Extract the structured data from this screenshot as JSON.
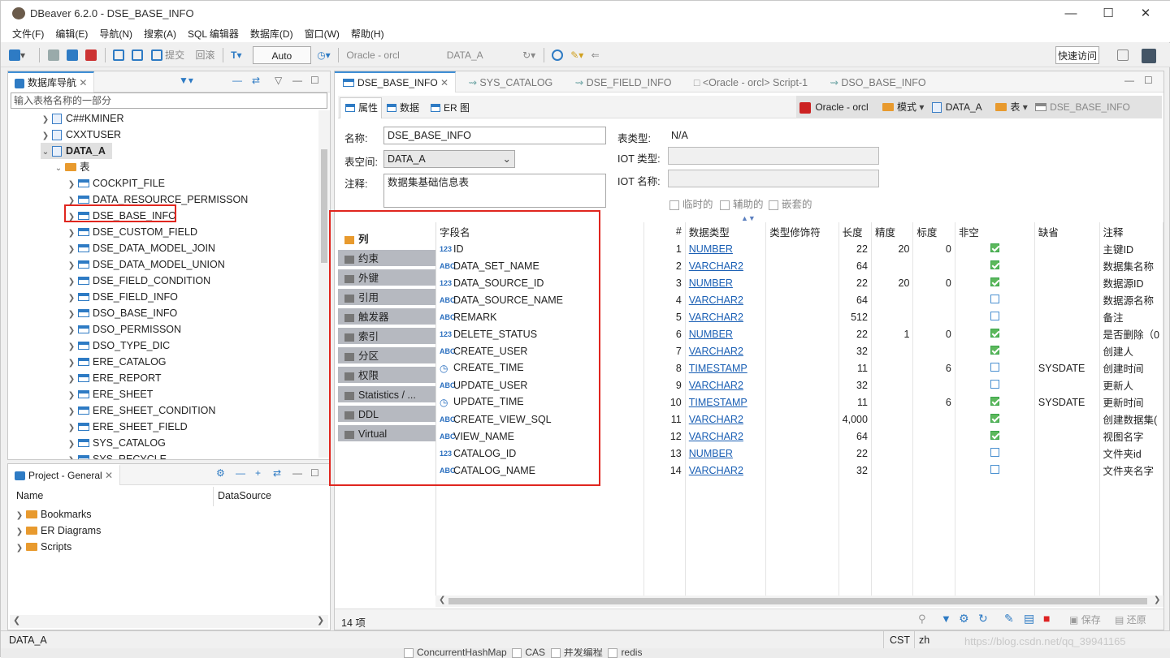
{
  "window": {
    "title": "DBeaver 6.2.0 - DSE_BASE_INFO"
  },
  "menu": [
    "文件(F)",
    "编辑(E)",
    "导航(N)",
    "搜索(A)",
    "SQL 编辑器",
    "数据库(D)",
    "窗口(W)",
    "帮助(H)"
  ],
  "toolbar": {
    "commit": "提交",
    "rollback": "回滚",
    "mode": "Auto",
    "connection": "Oracle - orcl",
    "schema": "DATA_A",
    "quick_access": "快速访问"
  },
  "navigator": {
    "tab": "数据库导航",
    "filter_placeholder": "输入表格名称的一部分",
    "users": [
      "C##KMINER",
      "CXXTUSER"
    ],
    "schema": "DATA_A",
    "tables_folder": "表",
    "tables": [
      "COCKPIT_FILE",
      "DATA_RESOURCE_PERMISSON",
      "DSE_BASE_INFO",
      "DSE_CUSTOM_FIELD",
      "DSE_DATA_MODEL_JOIN",
      "DSE_DATA_MODEL_UNION",
      "DSE_FIELD_CONDITION",
      "DSE_FIELD_INFO",
      "DSO_BASE_INFO",
      "DSO_PERMISSON",
      "DSO_TYPE_DIC",
      "ERE_CATALOG",
      "ERE_REPORT",
      "ERE_SHEET",
      "ERE_SHEET_CONDITION",
      "ERE_SHEET_FIELD",
      "SYS_CATALOG",
      "SYS_RECYCLE"
    ]
  },
  "project": {
    "tab": "Project - General",
    "col_name": "Name",
    "col_datasource": "DataSource",
    "items": [
      "Bookmarks",
      "ER Diagrams",
      "Scripts"
    ]
  },
  "editor_tabs": [
    "DSE_BASE_INFO",
    "SYS_CATALOG",
    "DSE_FIELD_INFO",
    "<Oracle - orcl> Script-1",
    "DSO_BASE_INFO"
  ],
  "sub_tabs": [
    "属性",
    "数据",
    "ER 图"
  ],
  "breadcrumb": [
    "Oracle - orcl",
    "模式",
    "DATA_A",
    "表",
    "DSE_BASE_INFO"
  ],
  "props": {
    "name_label": "名称:",
    "name_value": "DSE_BASE_INFO",
    "tablespace_label": "表空间:",
    "tablespace_value": "DATA_A",
    "comment_label": "注释:",
    "comment_value": "数据集基础信息表",
    "type_label": "表类型:",
    "type_value": "N/A",
    "iot_type_label": "IOT 类型:",
    "iot_name_label": "IOT 名称:",
    "temp": "临时的",
    "secondary": "辅助的",
    "nested": "嵌套的"
  },
  "side_tabs": [
    "列",
    "约束",
    "外键",
    "引用",
    "触发器",
    "索引",
    "分区",
    "权限",
    "Statistics / ...",
    "DDL",
    "Virtual"
  ],
  "columns_header": [
    "字段名",
    "#",
    "数据类型",
    "类型修饰符",
    "长度",
    "精度",
    "标度",
    "非空",
    "缺省",
    "注释"
  ],
  "columns": [
    {
      "icon": "123",
      "name": "ID",
      "no": "1",
      "type": "NUMBER",
      "len": "22",
      "prec": "20",
      "scale": "0",
      "notnull": true,
      "def": "",
      "comment": "主键ID"
    },
    {
      "icon": "ABC",
      "name": "DATA_SET_NAME",
      "no": "2",
      "type": "VARCHAR2",
      "len": "64",
      "prec": "",
      "scale": "",
      "notnull": true,
      "def": "",
      "comment": "数据集名称"
    },
    {
      "icon": "123",
      "name": "DATA_SOURCE_ID",
      "no": "3",
      "type": "NUMBER",
      "len": "22",
      "prec": "20",
      "scale": "0",
      "notnull": true,
      "def": "",
      "comment": "数据源ID"
    },
    {
      "icon": "ABC",
      "name": "DATA_SOURCE_NAME",
      "no": "4",
      "type": "VARCHAR2",
      "len": "64",
      "prec": "",
      "scale": "",
      "notnull": false,
      "def": "",
      "comment": "数据源名称"
    },
    {
      "icon": "ABC",
      "name": "REMARK",
      "no": "5",
      "type": "VARCHAR2",
      "len": "512",
      "prec": "",
      "scale": "",
      "notnull": false,
      "def": "",
      "comment": "备注"
    },
    {
      "icon": "123",
      "name": "DELETE_STATUS",
      "no": "6",
      "type": "NUMBER",
      "len": "22",
      "prec": "1",
      "scale": "0",
      "notnull": true,
      "def": "",
      "comment": "是否删除（0"
    },
    {
      "icon": "ABC",
      "name": "CREATE_USER",
      "no": "7",
      "type": "VARCHAR2",
      "len": "32",
      "prec": "",
      "scale": "",
      "notnull": true,
      "def": "",
      "comment": "创建人"
    },
    {
      "icon": "clock",
      "name": "CREATE_TIME",
      "no": "8",
      "type": "TIMESTAMP",
      "len": "11",
      "prec": "",
      "scale": "6",
      "notnull": false,
      "def": "SYSDATE",
      "comment": "创建时间"
    },
    {
      "icon": "ABC",
      "name": "UPDATE_USER",
      "no": "9",
      "type": "VARCHAR2",
      "len": "32",
      "prec": "",
      "scale": "",
      "notnull": false,
      "def": "",
      "comment": "更新人"
    },
    {
      "icon": "clock",
      "name": "UPDATE_TIME",
      "no": "10",
      "type": "TIMESTAMP",
      "len": "11",
      "prec": "",
      "scale": "6",
      "notnull": true,
      "def": "SYSDATE",
      "comment": "更新时间"
    },
    {
      "icon": "ABC",
      "name": "CREATE_VIEW_SQL",
      "no": "11",
      "type": "VARCHAR2",
      "len": "4,000",
      "prec": "",
      "scale": "",
      "notnull": true,
      "def": "",
      "comment": "创建数据集("
    },
    {
      "icon": "ABC",
      "name": "VIEW_NAME",
      "no": "12",
      "type": "VARCHAR2",
      "len": "64",
      "prec": "",
      "scale": "",
      "notnull": true,
      "def": "",
      "comment": "视图名字"
    },
    {
      "icon": "123",
      "name": "CATALOG_ID",
      "no": "13",
      "type": "NUMBER",
      "len": "22",
      "prec": "",
      "scale": "",
      "notnull": false,
      "def": "",
      "comment": "文件夹id"
    },
    {
      "icon": "ABC",
      "name": "CATALOG_NAME",
      "no": "14",
      "type": "VARCHAR2",
      "len": "32",
      "prec": "",
      "scale": "",
      "notnull": false,
      "def": "",
      "comment": "文件夹名字"
    }
  ],
  "bottom": {
    "count": "14 项",
    "save": "保存",
    "restore": "还原"
  },
  "status": {
    "schema": "DATA_A",
    "tz": "CST",
    "locale": "zh",
    "watermark": "https://blog.csdn.net/qq_39941165"
  },
  "behind": [
    "ConcurrentHashMap",
    "CAS",
    "并发编程",
    "redis"
  ],
  "colors": {
    "accent": "#3f8fd6",
    "highlight": "#e0261f",
    "link": "#1a5fb4",
    "check": "#5cb85c"
  }
}
